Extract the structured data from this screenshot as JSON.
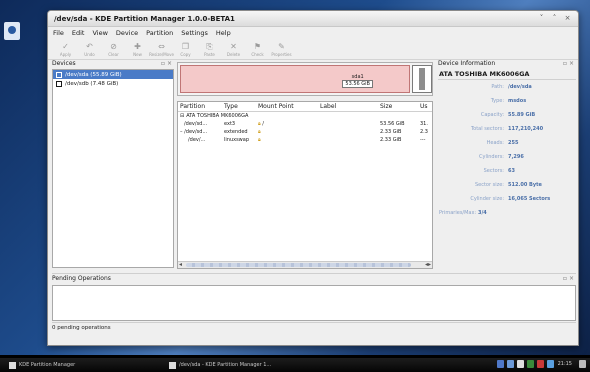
{
  "window": {
    "title": "/dev/sda - KDE Partition Manager 1.0.0-BETA1",
    "controls": [
      "˅",
      "˄",
      "×"
    ]
  },
  "menu": [
    "File",
    "Edit",
    "View",
    "Device",
    "Partition",
    "Settings",
    "Help"
  ],
  "toolbar": [
    {
      "label": "Apply",
      "icon": "apply-icon"
    },
    {
      "label": "Undo",
      "icon": "undo-icon"
    },
    {
      "label": "Clear",
      "icon": "clear-icon"
    },
    {
      "label": "New",
      "icon": "new-icon"
    },
    {
      "label": "Resize/Move",
      "icon": "resize-move-icon"
    },
    {
      "label": "Copy",
      "icon": "copy-icon"
    },
    {
      "label": "Paste",
      "icon": "paste-icon"
    },
    {
      "label": "Delete",
      "icon": "delete-icon"
    },
    {
      "label": "Check",
      "icon": "check-icon"
    },
    {
      "label": "Properties",
      "icon": "properties-icon"
    }
  ],
  "devices": {
    "title": "Devices",
    "items": [
      {
        "label": "/dev/sda (55.89 GiB)",
        "selected": true
      },
      {
        "label": "/dev/sdb (7.48 GiB)",
        "selected": false
      }
    ]
  },
  "partition_map": {
    "name": "sda1",
    "size": "53.56 GiB"
  },
  "table": {
    "headers": [
      "Partition",
      "Type",
      "Mount Point",
      "Label",
      "Size",
      "Us"
    ],
    "device_row": "ATA TOSHIBA MK6006GA",
    "rows": [
      {
        "partition": "/dev/sd...",
        "type": "ext3",
        "mount": "/",
        "label": "",
        "size": "53.56 GiB",
        "used": "31."
      },
      {
        "partition": "/dev/sd...",
        "type": "extended",
        "mount": "",
        "label": "",
        "size": "2.33 GiB",
        "used": "2.3"
      },
      {
        "partition": "/dev/...",
        "type": "linuxswap",
        "mount": "",
        "label": "",
        "size": "2.33 GiB",
        "used": "---"
      }
    ]
  },
  "device_info": {
    "title": "Device Information",
    "device_name": "ATA TOSHIBA MK6006GA",
    "rows": [
      {
        "key": "Path:",
        "value": "/dev/sda"
      },
      {
        "key": "Type:",
        "value": "msdos"
      },
      {
        "key": "Capacity:",
        "value": "55.89 GiB"
      },
      {
        "key": "Total sectors:",
        "value": "117,210,240"
      },
      {
        "key": "Heads:",
        "value": "255"
      },
      {
        "key": "Cylinders:",
        "value": "7,296"
      },
      {
        "key": "Sectors:",
        "value": "63"
      },
      {
        "key": "Sector size:",
        "value": "512.00 Byte"
      },
      {
        "key": "Cylinder size:",
        "value": "16,065 Sectors"
      },
      {
        "key": "Primaries/Max:",
        "value": "3/4"
      }
    ]
  },
  "pending": {
    "title": "Pending Operations",
    "status": "0 pending operations"
  },
  "taskbar": {
    "tasks": [
      "KDE Partition Manager",
      "/dev/sda - KDE Partition Manager 1..."
    ],
    "clock": "21:15",
    "tray_colors": [
      "#4f78c8",
      "#6d9ad8",
      "#e0e0e0",
      "#3a8a3a",
      "#c83a3a",
      "#5aa0e0"
    ]
  }
}
